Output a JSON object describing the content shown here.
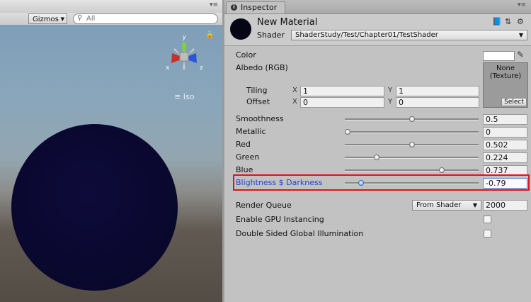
{
  "scene": {
    "gizmos_label": "Gizmos",
    "search_placeholder": "All",
    "iso_label": "Iso",
    "axes": {
      "x": "x",
      "y": "y",
      "z": "z"
    }
  },
  "inspector": {
    "tab_label": "Inspector",
    "material_name": "New Material",
    "shader_label": "Shader",
    "shader_value": "ShaderStudy/Test/Chapter01/TestShader"
  },
  "properties": {
    "color_label": "Color",
    "albedo_label": "Albedo (RGB)",
    "texture_none": "None\n(Texture)",
    "texture_select": "Select",
    "tiling_label": "Tiling",
    "offset_label": "Offset",
    "axis_x": "X",
    "axis_y": "Y",
    "tiling_x": "1",
    "tiling_y": "1",
    "offset_x": "0",
    "offset_y": "0",
    "sliders": [
      {
        "label": "Smoothness",
        "value": "0.5",
        "fraction": 0.5
      },
      {
        "label": "Metallic",
        "value": "0",
        "fraction": 0.0
      },
      {
        "label": "Red",
        "value": "0.502",
        "fraction": 0.502
      },
      {
        "label": "Green",
        "value": "0.224",
        "fraction": 0.224
      },
      {
        "label": "Blue",
        "value": "0.737",
        "fraction": 0.737
      },
      {
        "label": "Blightness $ Darkness",
        "value": "-0.79",
        "fraction": 0.105
      }
    ],
    "render_queue_label": "Render Queue",
    "render_queue_mode": "From Shader",
    "render_queue_value": "2000",
    "gpu_instancing_label": "Enable GPU Instancing",
    "double_sided_gi_label": "Double Sided Global Illumination"
  },
  "colors": {
    "highlight": "#e0131c",
    "active_label": "#2445c8",
    "sphere": "#0a0830"
  }
}
